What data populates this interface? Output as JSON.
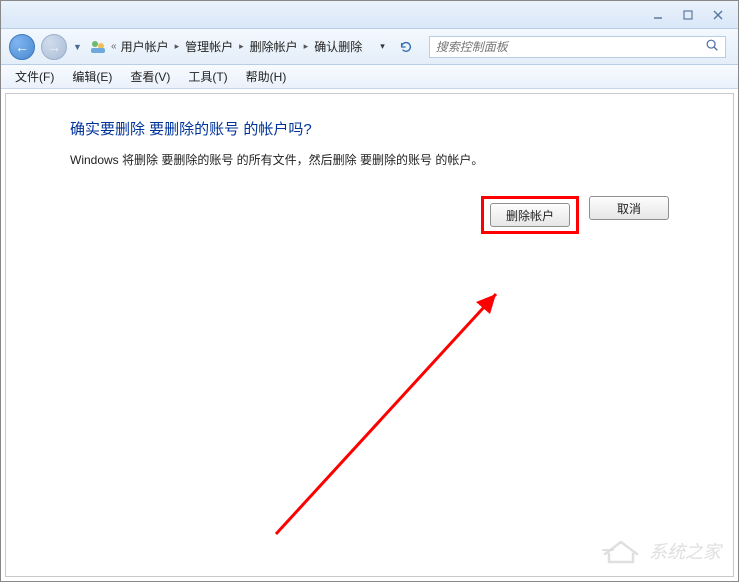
{
  "window": {
    "minimize": "—",
    "maximize": "☐",
    "close": "×"
  },
  "nav": {
    "back": "←",
    "fwd": "→"
  },
  "breadcrumb": {
    "prefix": "«",
    "items": [
      "用户帐户",
      "管理帐户",
      "删除帐户",
      "确认删除"
    ]
  },
  "search": {
    "placeholder": "搜索控制面板"
  },
  "menus": [
    "文件(F)",
    "编辑(E)",
    "查看(V)",
    "工具(T)",
    "帮助(H)"
  ],
  "page": {
    "heading": "确实要删除 要删除的账号 的帐户吗?",
    "body": "Windows 将删除 要删除的账号 的所有文件，然后删除 要删除的账号 的帐户。",
    "confirm_label": "删除帐户",
    "cancel_label": "取消"
  },
  "watermark": {
    "text": "系统之家"
  },
  "colors": {
    "highlight": "#ff0000",
    "link": "#003399"
  }
}
